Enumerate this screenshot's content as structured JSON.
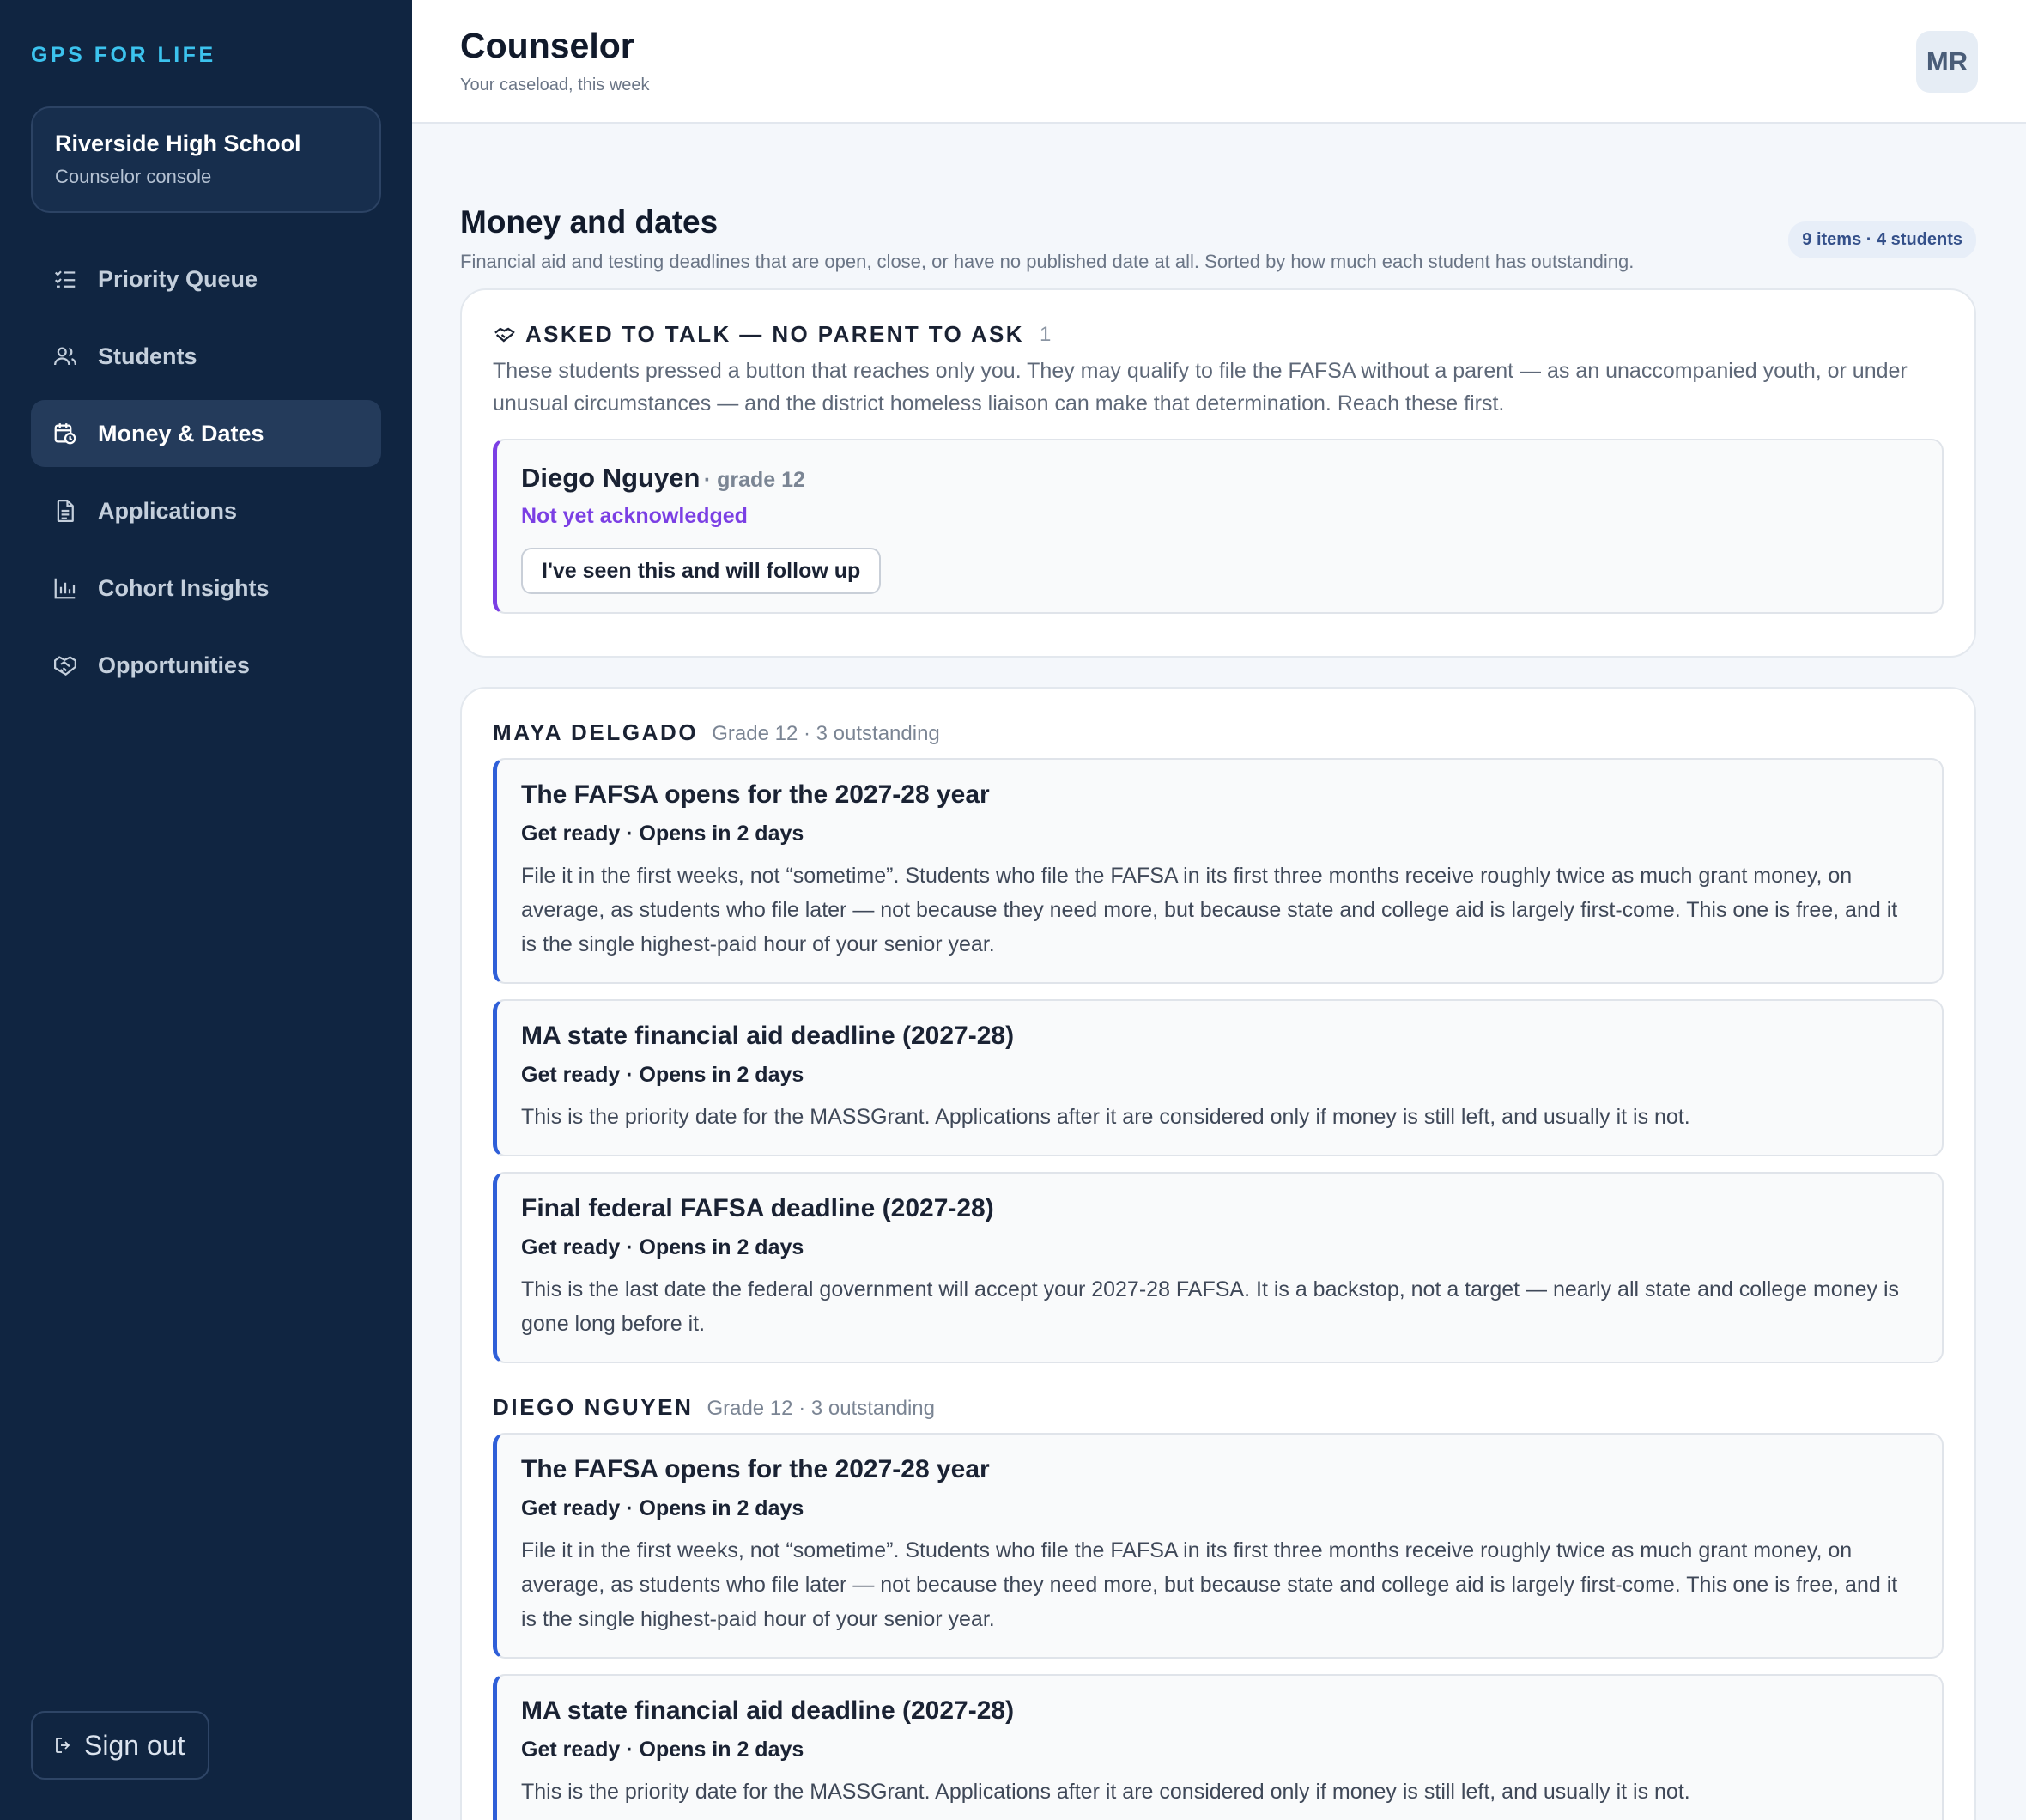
{
  "brand": "GPS FOR LIFE",
  "school": {
    "name": "Riverside High School",
    "subtitle": "Counselor console"
  },
  "nav": [
    {
      "label": "Priority Queue",
      "icon": "checklist-icon",
      "active": false
    },
    {
      "label": "Students",
      "icon": "users-icon",
      "active": false
    },
    {
      "label": "Money & Dates",
      "icon": "calendar-clock-icon",
      "active": true
    },
    {
      "label": "Applications",
      "icon": "document-icon",
      "active": false
    },
    {
      "label": "Cohort Insights",
      "icon": "bar-chart-icon",
      "active": false
    },
    {
      "label": "Opportunities",
      "icon": "handshake-icon",
      "active": false
    }
  ],
  "signout": "Sign out",
  "header": {
    "title": "Counselor",
    "subtitle": "Your caseload, this week",
    "avatar": "MR"
  },
  "section": {
    "title": "Money and dates",
    "subtitle": "Financial aid and testing deadlines that are open, close, or have no published date at all. Sorted by how much each student has outstanding.",
    "count": "9 items · 4 students"
  },
  "ask": {
    "title": "ASKED TO TALK — NO PARENT TO ASK",
    "count": "1",
    "description": "These students pressed a button that reaches only you. They may qualify to file the FAFSA without a parent — as an unaccompanied youth, or under unusual circumstances — and the district homeless liaison can make that determination. Reach these first.",
    "student": {
      "name": "Diego Nguyen",
      "grade": "· grade 12",
      "status": "Not yet acknowledged",
      "button": "I've seen this and will follow up"
    }
  },
  "students": [
    {
      "name": "MAYA DELGADO",
      "meta": "Grade 12 · 3 outstanding",
      "items": [
        {
          "title": "The FAFSA opens for the 2027-28 year",
          "status": "Get ready · Opens in 2 days",
          "description": "File it in the first weeks, not “sometime”. Students who file the FAFSA in its first three months receive roughly twice as much grant money, on average, as students who file later — not because they need more, but because state and college aid is largely first-come. This one is free, and it is the single highest-paid hour of your senior year."
        },
        {
          "title": "MA state financial aid deadline (2027-28)",
          "status": "Get ready · Opens in 2 days",
          "description": "This is the priority date for the MASSGrant. Applications after it are considered only if money is still left, and usually it is not."
        },
        {
          "title": "Final federal FAFSA deadline (2027-28)",
          "status": "Get ready · Opens in 2 days",
          "description": "This is the last date the federal government will accept your 2027-28 FAFSA. It is a backstop, not a target — nearly all state and college money is gone long before it."
        }
      ]
    },
    {
      "name": "DIEGO NGUYEN",
      "meta": "Grade 12 · 3 outstanding",
      "items": [
        {
          "title": "The FAFSA opens for the 2027-28 year",
          "status": "Get ready · Opens in 2 days",
          "description": "File it in the first weeks, not “sometime”. Students who file the FAFSA in its first three months receive roughly twice as much grant money, on average, as students who file later — not because they need more, but because state and college aid is largely first-come. This one is free, and it is the single highest-paid hour of your senior year."
        },
        {
          "title": "MA state financial aid deadline (2027-28)",
          "status": "Get ready · Opens in 2 days",
          "description": "This is the priority date for the MASSGrant. Applications after it are considered only if money is still left, and usually it is not."
        }
      ]
    }
  ]
}
